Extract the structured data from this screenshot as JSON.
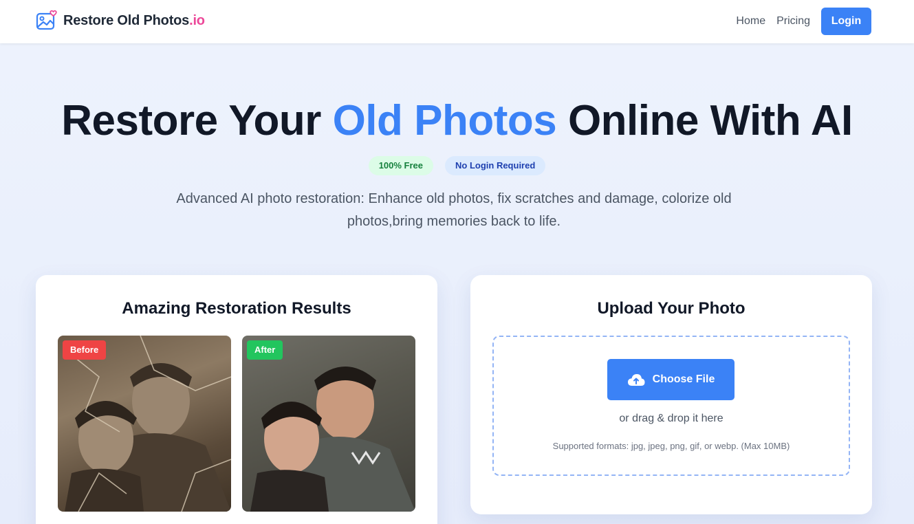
{
  "header": {
    "logo_text": "Restore Old Photos",
    "logo_accent": ".io",
    "nav": {
      "home": "Home",
      "pricing": "Pricing",
      "login": "Login"
    }
  },
  "hero": {
    "title_part1": "Restore Your ",
    "title_accent": "Old Photos",
    "title_part2": " Online With AI",
    "badges": {
      "free": "100% Free",
      "no_login": "No Login Required"
    },
    "subtitle": "Advanced AI photo restoration: Enhance old photos, fix scratches and damage, colorize old photos,bring memories back to life."
  },
  "results": {
    "title": "Amazing Restoration Results",
    "before_label": "Before",
    "after_label": "After"
  },
  "upload": {
    "title": "Upload Your Photo",
    "button": "Choose File",
    "drag_text": "or drag & drop it here",
    "formats": "Supported formats: jpg, jpeg, png, gif, or webp. (Max 10MB)"
  },
  "colors": {
    "primary": "#3b82f6",
    "brand_accent": "#ec4899",
    "before_tag": "#ef4444",
    "after_tag": "#22c55e"
  },
  "icons": [
    "image-heart-logo-icon",
    "cloud-upload-icon"
  ]
}
